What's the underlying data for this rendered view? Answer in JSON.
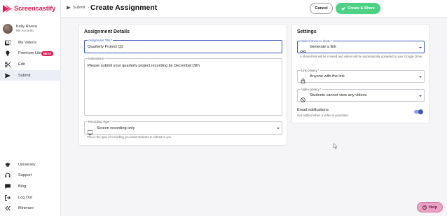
{
  "app": {
    "name": "Screencastify"
  },
  "user": {
    "name": "Kelly Rivera",
    "subtitle": "My Account"
  },
  "nav": {
    "top": [
      {
        "label": "My Videos",
        "icon": "video-library-icon"
      },
      {
        "label": "Premium Library",
        "icon": "lightbulb-icon",
        "badge": "BETA"
      },
      {
        "label": "Edit",
        "icon": "scissors-icon"
      },
      {
        "label": "Submit",
        "icon": "send-icon",
        "active": true
      }
    ],
    "bottom": [
      {
        "label": "University",
        "icon": "graduation-cap-icon"
      },
      {
        "label": "Support",
        "icon": "headset-icon"
      },
      {
        "label": "Blog",
        "icon": "chat-icon"
      },
      {
        "label": "Log Out",
        "icon": "logout-icon"
      },
      {
        "label": "Minimize",
        "icon": "double-chevron-left-icon"
      }
    ]
  },
  "header": {
    "breadcrumb": "Submit",
    "separator": "›",
    "title": "Create Assignment",
    "cancel_label": "Cancel",
    "create_label": "Create & Share"
  },
  "details": {
    "heading": "Assignment Details",
    "title_label": "Assignment Title *",
    "title_value": "Quarterly Project Q2",
    "instructions_label": "Instructions",
    "instructions_value": "Please submit your quarterly project recording by December19th",
    "recording_label": "Recording Type *",
    "recording_value": "Screen recording only",
    "recording_helper": "This is the type of recording you want students to submit to you."
  },
  "settings": {
    "heading": "Settings",
    "share_label": "Select where to share *",
    "share_value": "Generate a link",
    "share_helper": "A shared link will be created and videos will be automatically uploaded to your Google Drive.",
    "link_privacy_label": "Link privacy *",
    "link_privacy_value": "Anyone with the link",
    "video_privacy_label": "Video privacy *",
    "video_privacy_value": "Students cannot view any videos",
    "email_title": "Email notifications",
    "email_sub": "Get notified when a video is submitted.",
    "email_enabled": true
  },
  "help": {
    "label": "Help"
  },
  "colors": {
    "brand": "#e01e5a",
    "accent": "#3a57b5",
    "success": "#4cd285"
  }
}
